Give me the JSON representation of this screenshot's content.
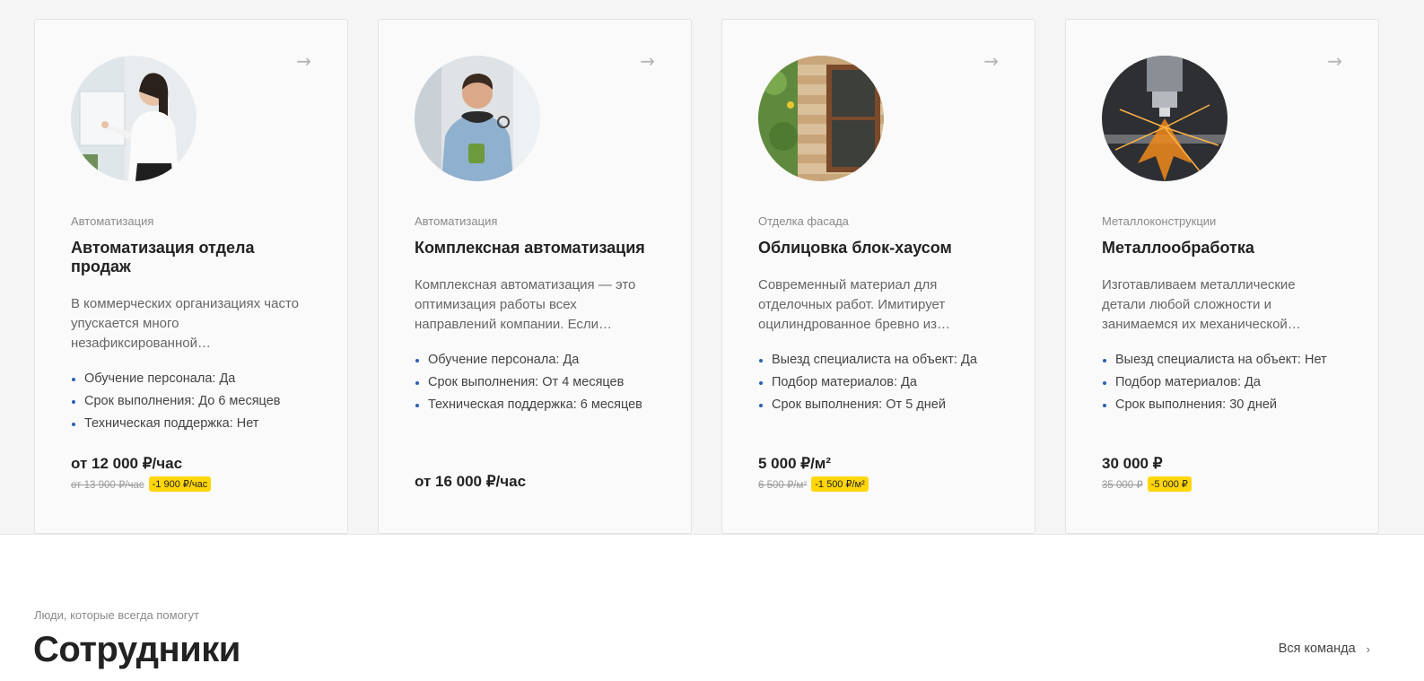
{
  "cards": [
    {
      "category": "Автоматизация",
      "title": "Автоматизация отдела продаж",
      "description": "В коммерческих организациях часто упускается много незафиксированной…",
      "props": [
        {
          "text": "Обучение персонала:  Да"
        },
        {
          "text": "Срок выполнения:  До 6 месяцев"
        },
        {
          "text": "Техническая поддержка:  Нет"
        }
      ],
      "price": "от 12 000 ₽/час",
      "old_price": "от 13 900 ₽/час",
      "discount": "-1 900 ₽/час",
      "arrow": "→",
      "image": "woman-at-whiteboard-photo"
    },
    {
      "category": "Автоматизация",
      "title": "Комплексная автоматизация",
      "description": "Комплексная автоматизация — это оптимизация работы всех направлений компании. Если…",
      "props": [
        {
          "text": "Обучение персонала:  Да"
        },
        {
          "text": "Срок выполнения:  От 4 месяцев"
        },
        {
          "text": "Техническая поддержка:  6 месяцев"
        }
      ],
      "price": "от 16 000 ₽/час",
      "old_price": "",
      "discount": "",
      "arrow": "→",
      "image": "smiling-man-with-cup-photo"
    },
    {
      "category": "Отделка фасада",
      "title": "Облицовка блок-хаусом",
      "description": "Современный материал для отделочных работ. Имитирует оцилиндрованное бревно из…",
      "props": [
        {
          "text": "Выезд специалиста на объект:  Да"
        },
        {
          "text": "Подбор материалов:  Да"
        },
        {
          "text": "Срок выполнения:  От 5 дней"
        }
      ],
      "price": "5 000 ₽/м²",
      "old_price": "6 500 ₽/м²",
      "discount": "-1 500 ₽/м²",
      "arrow": "→",
      "image": "log-wall-window-photo"
    },
    {
      "category": "Металлоконструкции",
      "title": "Металлообработка",
      "description": "Изготавливаем металлические детали любой сложности и занимаемся их механической…",
      "props": [
        {
          "text": "Выезд специалиста на объект:  Нет"
        },
        {
          "text": "Подбор материалов:  Да"
        },
        {
          "text": "Срок выполнения:  30 дней"
        }
      ],
      "price": "30 000 ₽",
      "old_price": "35 000 ₽",
      "discount": "-5 000 ₽",
      "arrow": "→",
      "image": "laser-cutting-sparks-photo"
    }
  ],
  "team_section": {
    "subtitle": "Люди, которые всегда помогут",
    "title": "Сотрудники",
    "link_label": "Вся команда",
    "link_icon": "›"
  },
  "colors": {
    "bullet": "#2c5fb3",
    "discount_badge": "#ffd60a"
  }
}
